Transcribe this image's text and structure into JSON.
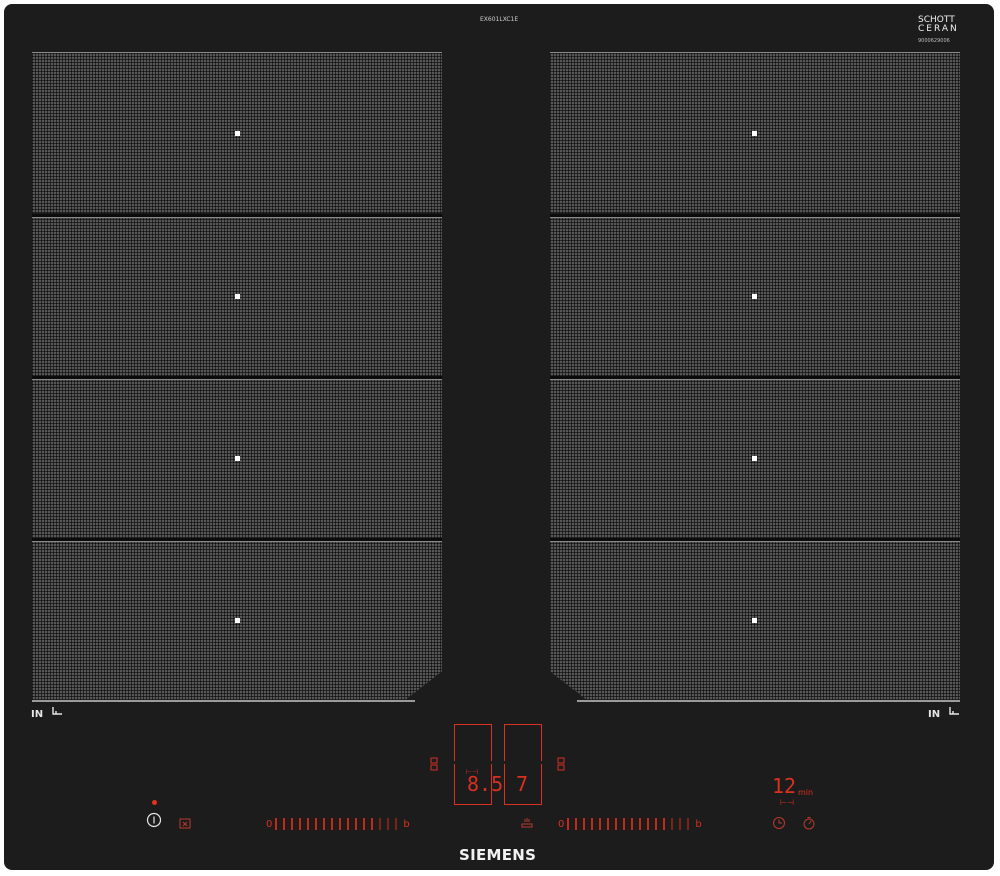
{
  "model_label": "EX601LXC1E",
  "brand_glass": {
    "line1": "SCHOTT",
    "line2": "CERAN",
    "serial": "9000629006"
  },
  "zone_left_label": "IN",
  "zone_right_label": "IN",
  "display_left": {
    "value": "8.5"
  },
  "display_right": {
    "value": "7"
  },
  "timer": {
    "value": "12",
    "unit": "min"
  },
  "slider_left": {
    "start": "0",
    "end": "b"
  },
  "slider_right": {
    "start": "0",
    "end": "b"
  },
  "brand": "SIEMENS",
  "colors": {
    "glass": "#1c1c1c",
    "zone": "#565656",
    "indicator": "#d9301f"
  },
  "icons": [
    "power-icon",
    "child-lock-icon",
    "frying-sensor-icon",
    "timer-icon",
    "stopwatch-icon",
    "flex-zone-icon",
    "induction-icon"
  ]
}
